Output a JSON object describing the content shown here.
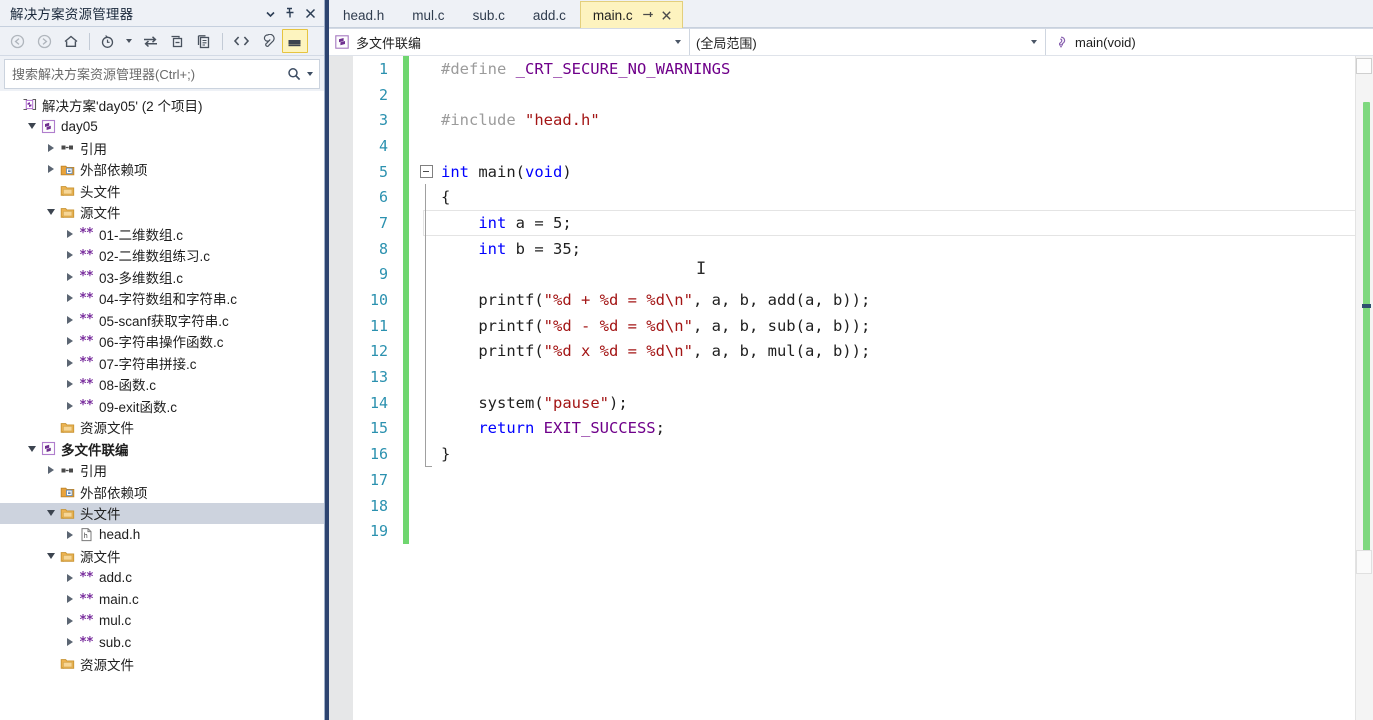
{
  "solution_explorer": {
    "title": "解决方案资源管理器",
    "window_buttons": [
      {
        "name": "dropdown",
        "glyph": "chevron-down-icon"
      },
      {
        "name": "pin",
        "glyph": "pin-icon"
      },
      {
        "name": "close",
        "glyph": "close-icon"
      }
    ],
    "toolbar": [
      {
        "name": "back-icon",
        "label": "后退",
        "state": "disabled"
      },
      {
        "name": "forward-icon",
        "label": "前进",
        "state": "disabled"
      },
      {
        "name": "home-icon",
        "label": "主页",
        "state": "normal"
      },
      {
        "name": "pending-changes-icon",
        "label": "挂起的更改筛选器",
        "state": "normal"
      },
      {
        "name": "sync-icon",
        "label": "与活动文档同步",
        "state": "normal"
      },
      {
        "name": "refresh-icon",
        "label": "刷新",
        "state": "normal"
      },
      {
        "name": "collapse-all-icon",
        "label": "全部折叠",
        "state": "normal"
      },
      {
        "name": "show-all-files-icon",
        "label": "显示所有文件",
        "state": "normal"
      },
      {
        "name": "properties-icon",
        "label": "属性",
        "state": "normal"
      },
      {
        "name": "preview-selected-items-icon",
        "label": "预览选定项",
        "state": "active"
      }
    ],
    "search": {
      "placeholder": "搜索解决方案资源管理器(Ctrl+;)",
      "value": ""
    },
    "tree": [
      {
        "depth": 0,
        "expander": "none",
        "icon": "solution-icon",
        "label": "解决方案'day05' (2 个项目)",
        "bold": false,
        "selected": false
      },
      {
        "depth": 1,
        "expander": "expanded",
        "icon": "project-icon",
        "label": "day05",
        "bold": false,
        "selected": false
      },
      {
        "depth": 2,
        "expander": "collapsed",
        "icon": "references-icon",
        "label": "引用",
        "bold": false,
        "selected": false
      },
      {
        "depth": 2,
        "expander": "collapsed",
        "icon": "ext-dep-icon",
        "label": "外部依赖项",
        "bold": false,
        "selected": false
      },
      {
        "depth": 2,
        "expander": "none",
        "icon": "folder-icon",
        "label": "头文件",
        "bold": false,
        "selected": false
      },
      {
        "depth": 2,
        "expander": "expanded",
        "icon": "folder-icon",
        "label": "源文件",
        "bold": false,
        "selected": false
      },
      {
        "depth": 3,
        "expander": "collapsed",
        "icon": "c-file-icon",
        "label": "01-二维数组.c",
        "bold": false,
        "selected": false
      },
      {
        "depth": 3,
        "expander": "collapsed",
        "icon": "c-file-icon",
        "label": "02-二维数组练习.c",
        "bold": false,
        "selected": false
      },
      {
        "depth": 3,
        "expander": "collapsed",
        "icon": "c-file-icon",
        "label": "03-多维数组.c",
        "bold": false,
        "selected": false
      },
      {
        "depth": 3,
        "expander": "collapsed",
        "icon": "c-file-icon",
        "label": "04-字符数组和字符串.c",
        "bold": false,
        "selected": false
      },
      {
        "depth": 3,
        "expander": "collapsed",
        "icon": "c-file-icon",
        "label": "05-scanf获取字符串.c",
        "bold": false,
        "selected": false
      },
      {
        "depth": 3,
        "expander": "collapsed",
        "icon": "c-file-icon",
        "label": "06-字符串操作函数.c",
        "bold": false,
        "selected": false
      },
      {
        "depth": 3,
        "expander": "collapsed",
        "icon": "c-file-icon",
        "label": "07-字符串拼接.c",
        "bold": false,
        "selected": false
      },
      {
        "depth": 3,
        "expander": "collapsed",
        "icon": "c-file-icon",
        "label": "08-函数.c",
        "bold": false,
        "selected": false
      },
      {
        "depth": 3,
        "expander": "collapsed",
        "icon": "c-file-icon",
        "label": "09-exit函数.c",
        "bold": false,
        "selected": false
      },
      {
        "depth": 2,
        "expander": "none",
        "icon": "folder-icon",
        "label": "资源文件",
        "bold": false,
        "selected": false
      },
      {
        "depth": 1,
        "expander": "expanded",
        "icon": "project-icon",
        "label": "多文件联编",
        "bold": true,
        "selected": false
      },
      {
        "depth": 2,
        "expander": "collapsed",
        "icon": "references-icon",
        "label": "引用",
        "bold": false,
        "selected": false
      },
      {
        "depth": 2,
        "expander": "none",
        "icon": "ext-dep-icon",
        "label": "外部依赖项",
        "bold": false,
        "selected": false
      },
      {
        "depth": 2,
        "expander": "expanded",
        "icon": "folder-icon",
        "label": "头文件",
        "bold": false,
        "selected": true
      },
      {
        "depth": 3,
        "expander": "collapsed",
        "icon": "h-file-icon",
        "label": "head.h",
        "bold": false,
        "selected": false
      },
      {
        "depth": 2,
        "expander": "expanded",
        "icon": "folder-icon",
        "label": "源文件",
        "bold": false,
        "selected": false
      },
      {
        "depth": 3,
        "expander": "collapsed",
        "icon": "c-file-icon",
        "label": "add.c",
        "bold": false,
        "selected": false
      },
      {
        "depth": 3,
        "expander": "collapsed",
        "icon": "c-file-icon",
        "label": "main.c",
        "bold": false,
        "selected": false
      },
      {
        "depth": 3,
        "expander": "collapsed",
        "icon": "c-file-icon",
        "label": "mul.c",
        "bold": false,
        "selected": false
      },
      {
        "depth": 3,
        "expander": "collapsed",
        "icon": "c-file-icon",
        "label": "sub.c",
        "bold": false,
        "selected": false
      },
      {
        "depth": 2,
        "expander": "none",
        "icon": "folder-icon",
        "label": "资源文件",
        "bold": false,
        "selected": false
      }
    ]
  },
  "editor": {
    "tabs": [
      {
        "label": "head.h",
        "active": false
      },
      {
        "label": "mul.c",
        "active": false
      },
      {
        "label": "sub.c",
        "active": false
      },
      {
        "label": "add.c",
        "active": false
      },
      {
        "label": "main.c",
        "active": true
      }
    ],
    "active_tab_buttons": {
      "pin": "pin-icon",
      "close": "close-icon"
    },
    "navbar": {
      "project": "多文件联编",
      "scope": "(全局范围)",
      "member": "main(void)"
    },
    "current_line": 7,
    "lines": [
      {
        "n": 1,
        "changed": true,
        "fold": "none",
        "guide": "none",
        "tokens": [
          {
            "t": "#define ",
            "c": "c-pre"
          },
          {
            "t": "_CRT_SECURE_NO_WARNINGS",
            "c": "c-macro"
          }
        ]
      },
      {
        "n": 2,
        "changed": true,
        "fold": "none",
        "guide": "none",
        "tokens": []
      },
      {
        "n": 3,
        "changed": true,
        "fold": "none",
        "guide": "none",
        "tokens": [
          {
            "t": "#include ",
            "c": "c-pre"
          },
          {
            "t": "\"head.h\"",
            "c": "c-str"
          }
        ]
      },
      {
        "n": 4,
        "changed": true,
        "fold": "none",
        "guide": "none",
        "tokens": []
      },
      {
        "n": 5,
        "changed": true,
        "fold": "minus",
        "guide": "none",
        "tokens": [
          {
            "t": "int ",
            "c": "c-key"
          },
          {
            "t": "main",
            "c": "c-plain"
          },
          {
            "t": "(",
            "c": "c-punc"
          },
          {
            "t": "void",
            "c": "c-key"
          },
          {
            "t": ")",
            "c": "c-punc"
          }
        ]
      },
      {
        "n": 6,
        "changed": true,
        "fold": "none",
        "guide": "line",
        "tokens": [
          {
            "t": "{",
            "c": "c-punc"
          }
        ]
      },
      {
        "n": 7,
        "changed": true,
        "fold": "none",
        "guide": "line",
        "tokens": [
          {
            "t": "    ",
            "c": "c-plain"
          },
          {
            "t": "int ",
            "c": "c-key"
          },
          {
            "t": "a = 5;",
            "c": "c-plain"
          }
        ]
      },
      {
        "n": 8,
        "changed": true,
        "fold": "none",
        "guide": "line",
        "tokens": [
          {
            "t": "    ",
            "c": "c-plain"
          },
          {
            "t": "int ",
            "c": "c-key"
          },
          {
            "t": "b = 35;",
            "c": "c-plain"
          }
        ]
      },
      {
        "n": 9,
        "changed": true,
        "fold": "none",
        "guide": "line",
        "tokens": []
      },
      {
        "n": 10,
        "changed": true,
        "fold": "none",
        "guide": "line",
        "tokens": [
          {
            "t": "    printf(",
            "c": "c-plain"
          },
          {
            "t": "\"%d + %d = %d\\n\"",
            "c": "c-str"
          },
          {
            "t": ", a, b, add(a, b));",
            "c": "c-plain"
          }
        ]
      },
      {
        "n": 11,
        "changed": true,
        "fold": "none",
        "guide": "line",
        "tokens": [
          {
            "t": "    printf(",
            "c": "c-plain"
          },
          {
            "t": "\"%d - %d = %d\\n\"",
            "c": "c-str"
          },
          {
            "t": ", a, b, sub(a, b));",
            "c": "c-plain"
          }
        ]
      },
      {
        "n": 12,
        "changed": true,
        "fold": "none",
        "guide": "line",
        "tokens": [
          {
            "t": "    printf(",
            "c": "c-plain"
          },
          {
            "t": "\"%d x %d = %d\\n\"",
            "c": "c-str"
          },
          {
            "t": ", a, b, mul(a, b));",
            "c": "c-plain"
          }
        ]
      },
      {
        "n": 13,
        "changed": true,
        "fold": "none",
        "guide": "line",
        "tokens": []
      },
      {
        "n": 14,
        "changed": true,
        "fold": "none",
        "guide": "line",
        "tokens": [
          {
            "t": "    system(",
            "c": "c-plain"
          },
          {
            "t": "\"pause\"",
            "c": "c-str"
          },
          {
            "t": ");",
            "c": "c-plain"
          }
        ]
      },
      {
        "n": 15,
        "changed": true,
        "fold": "none",
        "guide": "line",
        "tokens": [
          {
            "t": "    ",
            "c": "c-plain"
          },
          {
            "t": "return ",
            "c": "c-key"
          },
          {
            "t": "EXIT_SUCCESS",
            "c": "c-macro"
          },
          {
            "t": ";",
            "c": "c-plain"
          }
        ]
      },
      {
        "n": 16,
        "changed": true,
        "fold": "none",
        "guide": "hook",
        "tokens": [
          {
            "t": "}",
            "c": "c-punc"
          }
        ]
      },
      {
        "n": 17,
        "changed": true,
        "fold": "none",
        "guide": "none",
        "tokens": []
      },
      {
        "n": 18,
        "changed": true,
        "fold": "none",
        "guide": "none",
        "tokens": []
      },
      {
        "n": 19,
        "changed": true,
        "fold": "none",
        "guide": "none",
        "tokens": []
      }
    ]
  },
  "colors": {
    "chrome": "#eef1f6",
    "frame_border": "#2d4470",
    "active_tab": "#fdf3bf",
    "selection": "#cdd3de",
    "line_number": "#2b91af",
    "keyword": "#0000ff",
    "string": "#a31515",
    "macro": "#6f008a",
    "preprocessor": "#9b9b9b",
    "change_bar": "#6fd66f"
  }
}
